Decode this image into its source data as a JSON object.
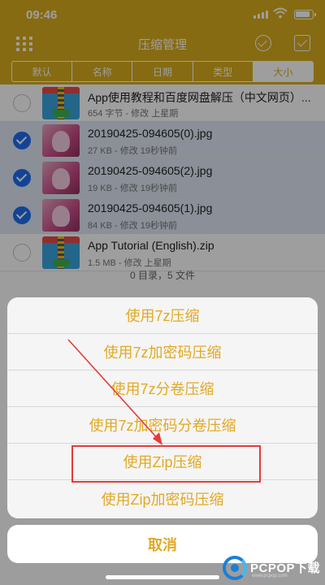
{
  "status": {
    "time": "09:46"
  },
  "nav": {
    "title": "压缩管理"
  },
  "sort_tabs": [
    "默认",
    "名称",
    "日期",
    "类型",
    "大小"
  ],
  "files": [
    {
      "name": "App使用教程和百度网盘解压（中文网页）...",
      "meta": "654 字节 - 修改 上星期",
      "kind": "zip",
      "selected": false
    },
    {
      "name": "20190425-094605(0).jpg",
      "meta": "27 KB - 修改 19秒钟前",
      "kind": "img",
      "selected": true
    },
    {
      "name": "20190425-094605(2).jpg",
      "meta": "19 KB - 修改 19秒钟前",
      "kind": "img",
      "selected": true
    },
    {
      "name": "20190425-094605(1).jpg",
      "meta": "84 KB - 修改 19秒钟前",
      "kind": "img",
      "selected": true
    },
    {
      "name": "App Tutorial (English).zip",
      "meta": "1.5 MB - 修改 上星期",
      "kind": "zip",
      "selected": false
    }
  ],
  "summary": "0 目录，5 文件",
  "sheet": {
    "options": [
      "使用7z压缩",
      "使用7z加密码压缩",
      "使用7z分卷压缩",
      "使用7z加密码分卷压缩",
      "使用Zip压缩",
      "使用Zip加密码压缩"
    ],
    "cancel": "取消"
  },
  "colors": {
    "accent": "#d9ad1e",
    "sheet_text": "#e1a924",
    "highlight": "#e53b3b",
    "selected_row": "#dfe7f6"
  },
  "watermark": {
    "brand": "PCPOP下载"
  }
}
